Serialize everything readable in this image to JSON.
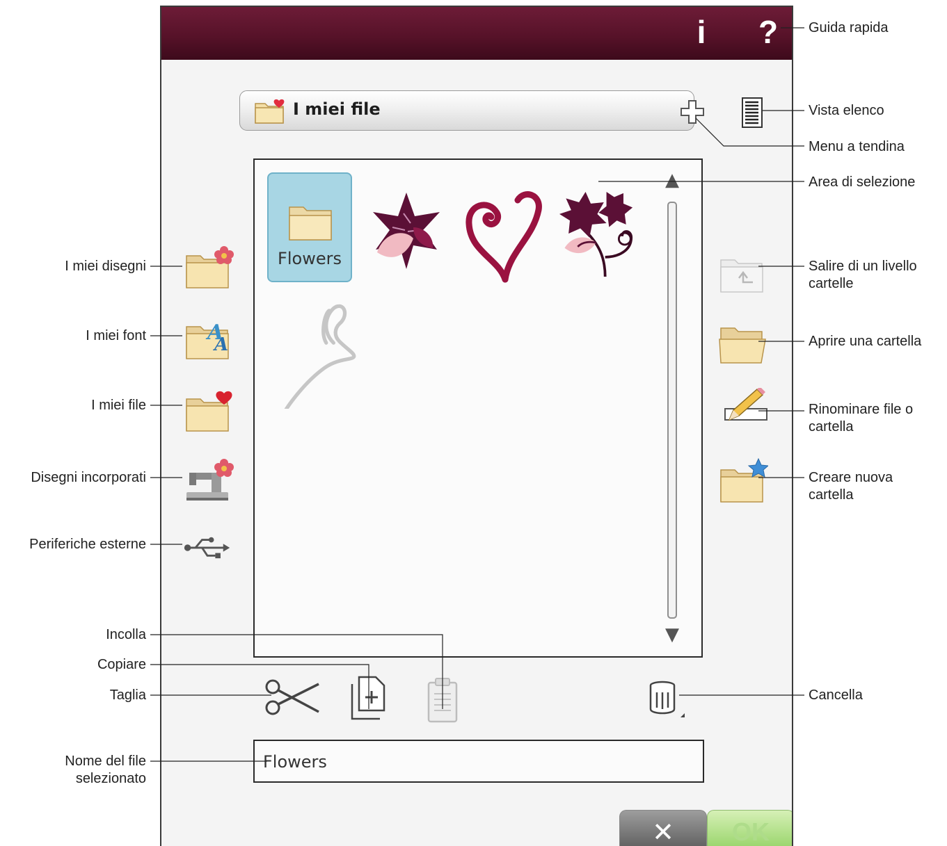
{
  "titlebar": {
    "info_label": "i",
    "help_label": "?"
  },
  "dropdown": {
    "label": "I miei file"
  },
  "selection_area": {
    "items": [
      {
        "type": "folder",
        "name": "Flowers",
        "selected": true
      },
      {
        "type": "design",
        "name": "leaf-flower"
      },
      {
        "type": "design",
        "name": "swirl-heart"
      },
      {
        "type": "design",
        "name": "leaf-branch"
      },
      {
        "type": "design",
        "name": "heart-ribbon"
      }
    ]
  },
  "selected_file_name": "Flowers",
  "buttons": {
    "cancel_label": "✕",
    "ok_label": "OK"
  },
  "annotations": {
    "guida_rapida": "Guida rapida",
    "vista_elenco": "Vista elenco",
    "menu_tendina": "Menu a tendina",
    "area_selezione": "Area di selezione",
    "miei_disegni": "I miei disegni",
    "miei_font": "I miei font",
    "miei_file": "I miei file",
    "disegni_incorporati": "Disegni incorporati",
    "periferiche_esterne": "Periferiche esterne",
    "salire_livello_1": "Salire di un livello",
    "salire_livello_2": "cartelle",
    "aprire_cartella": "Aprire una cartella",
    "rinominare_1": "Rinominare file o",
    "rinominare_2": "cartella",
    "creare_cartella_1": "Creare nuova",
    "creare_cartella_2": "cartella",
    "incolla": "Incolla",
    "copiare": "Copiare",
    "taglia": "Taglia",
    "cancella": "Cancella",
    "nome_file_1": "Nome del file",
    "nome_file_2": "selezionato"
  },
  "colors": {
    "titlebar": "#5a1530",
    "selected_tile": "#a8d6e4",
    "ok_button": "#8fd05f",
    "design_dark": "#5b1036",
    "design_light": "#f0b8c0"
  },
  "icons": [
    "folder-flower-icon",
    "folder-font-icon",
    "folder-heart-icon",
    "sewing-machine-icon",
    "usb-icon",
    "folder-up-icon",
    "folder-open-icon",
    "rename-pencil-icon",
    "folder-star-icon",
    "list-view-icon",
    "plus-icon",
    "scissors-icon",
    "copy-icon",
    "paste-icon",
    "trash-icon"
  ]
}
